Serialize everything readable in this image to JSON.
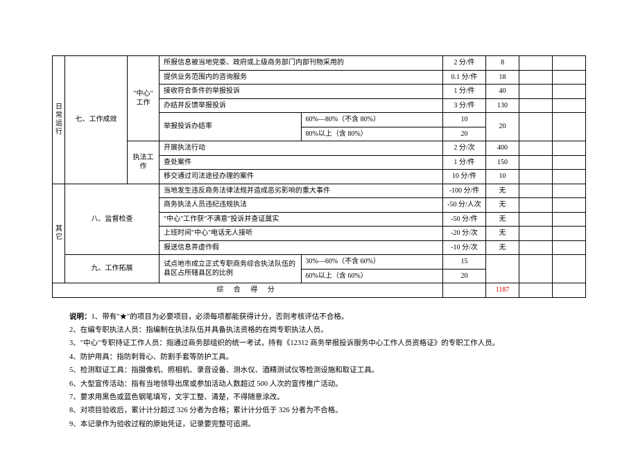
{
  "rows": {
    "r1_desc": "所报信息被当地党委、政府或上级商务部门内部刊物采用的",
    "r1_score": "2 分/件",
    "r1_count": "8",
    "section_daily": "日\n常\n运\n行",
    "sec7": "七、工作成效",
    "col_center": "\"中心\"\n工作",
    "col_law": "执法工作",
    "r2_desc": "提供业务范围内的咨询服务",
    "r2_score": "0.1 分/件",
    "r2_count": "18",
    "r3_desc": "接收符合条件的举报投诉",
    "r3_score": "1 分/件",
    "r3_count": "40",
    "r4_desc": "办结并反馈举报投诉",
    "r4_score": "3 分/件",
    "r4_count": "130",
    "r5_desc": "举报投诉办结率",
    "r5a_sub": "60%—80%（不含 80%）",
    "r5a_score": "10",
    "r5b_sub": "80%以上（含 80%）",
    "r5b_score": "20",
    "r5_count": "20",
    "r6_desc": "开展执法行动",
    "r6_score": "2 分/次",
    "r6_count": "400",
    "r7_desc": "查处案件",
    "r7_score": "1 分/件",
    "r7_count": "150",
    "r8_desc": "移交通过司法途径办理的案件",
    "r8_score": "10 分/件",
    "r8_count": "10",
    "section_other": "其\n它",
    "sec8": "八、监督检查",
    "r9_desc": "当地发生违反商务法律法规并造成恶劣影响的重大事件",
    "r9_score": "-100 分/件",
    "r9_count": "无",
    "r10_desc": "商务执法人员违纪违规执法",
    "r10_score": "-50 分/人次",
    "r10_count": "无",
    "r11_desc": "\"中心\"工作获\"不满意\"投诉并查证属实",
    "r11_score": "-50 分/件",
    "r11_count": "无",
    "r12_desc": "上班时间\"中心\"电话无人接听",
    "r12_score": "-20 分/次",
    "r12_count": "无",
    "r13_desc": "报送信息弄虚作假",
    "r13_score": "-10 分/次",
    "r13_count": "无",
    "sec9": "九、工作拓展",
    "r14_desc": "试点地市成立正式专职商务综合执法队伍的县区占所辖县区的比例",
    "r14a_sub": "30%—60%（不含 60%）",
    "r14a_score": "15",
    "r14b_sub": "60%以上（含 60%）",
    "r14b_score": "20",
    "total_label": "综 合 得 分",
    "total_value": "1187"
  },
  "notes": {
    "label": "说明：",
    "n1": "1、带有\"★\"的项目为必要项目，必须每项都能获得计分，否则考核评估不合格。",
    "n2": "2、在编专职执法人员：指编制在执法队伍并具备执法资格的在岗专职执法人员。",
    "n3": "3、\"中心\"专职持证工作人员：指通过商务部组织的统一考试，持有《12312 商务举报投诉服务中心工作人员资格证》的专职工作人员。",
    "n4": "4、防护用具：指防刺背心、防割手套等防护工具。",
    "n5": "5、检测取证工具：指摄像机、照相机、录音设备、测水仪、酒精测试仪等检测设施和取证工具。",
    "n6": "6、大型宣传活动：指有当地领导出席或参加活动人数超过 500 人次的宣传推广活动。",
    "n7": "7、要求用黑色或蓝色钢笔填写，文字工整、清楚，不得随意涂改。",
    "n8": "8、对项目验收后，累计计分超过 326 分者为合格；累计计分低于 326 分者为不合格。",
    "n9": "9、本记录作为验收过程的原始凭证，记录要完整可追溯。"
  }
}
